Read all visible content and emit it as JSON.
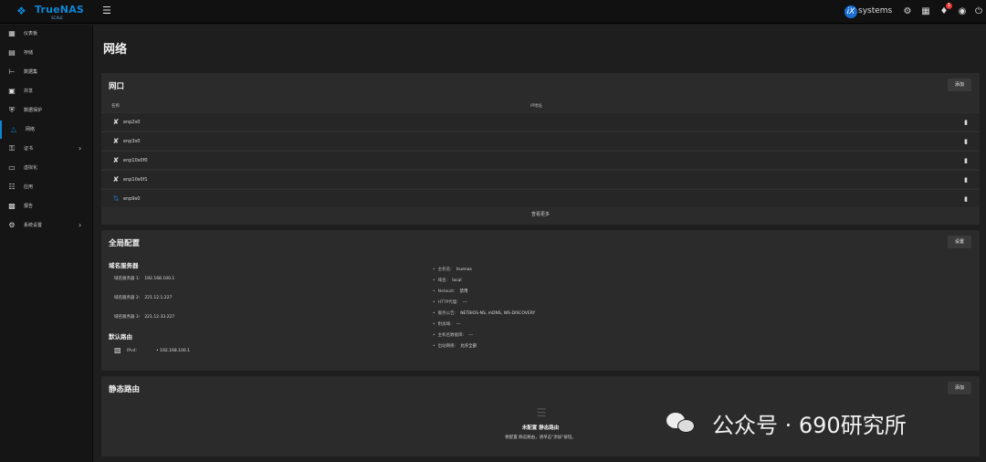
{
  "app": {
    "brand": "TrueNAS",
    "brand_sub": "SCALE",
    "vendor": "systems"
  },
  "colors": {
    "accent": "#0d86d4",
    "badge": "#e53935"
  },
  "topbar": {
    "menu_icon": "hamburger-icon",
    "icons": [
      "truecommand-icon",
      "clipboard-icon",
      "bell-icon",
      "account-icon",
      "power-icon"
    ],
    "notification_count": "1"
  },
  "sidebar": {
    "items": [
      {
        "label": "仪表板",
        "icon": "dashboard-icon",
        "active": false,
        "expandable": false
      },
      {
        "label": "存储",
        "icon": "storage-icon",
        "active": false,
        "expandable": false
      },
      {
        "label": "数据集",
        "icon": "datasets-icon",
        "active": false,
        "expandable": false
      },
      {
        "label": "共享",
        "icon": "shares-icon",
        "active": false,
        "expandable": false
      },
      {
        "label": "数据保护",
        "icon": "shield-icon",
        "active": false,
        "expandable": false
      },
      {
        "label": "网络",
        "icon": "network-icon",
        "active": true,
        "expandable": false
      },
      {
        "label": "证书",
        "icon": "key-icon",
        "active": false,
        "expandable": true
      },
      {
        "label": "虚拟化",
        "icon": "laptop-icon",
        "active": false,
        "expandable": false
      },
      {
        "label": "应用",
        "icon": "apps-icon",
        "active": false,
        "expandable": false
      },
      {
        "label": "报告",
        "icon": "reports-icon",
        "active": false,
        "expandable": false
      },
      {
        "label": "系统设置",
        "icon": "gear-icon",
        "active": false,
        "expandable": true
      }
    ]
  },
  "page": {
    "title": "网络"
  },
  "interfaces": {
    "title": "网口",
    "add_label": "添加",
    "columns": [
      "名称",
      "IP地址"
    ],
    "rows": [
      {
        "name": "enp2s0",
        "icon": "link-off-icon",
        "link_up": false
      },
      {
        "name": "enp3s0",
        "icon": "link-off-icon",
        "link_up": false
      },
      {
        "name": "enp10s0f0",
        "icon": "link-off-icon",
        "link_up": false
      },
      {
        "name": "enp10s0f1",
        "icon": "link-off-icon",
        "link_up": false
      },
      {
        "name": "enp9s0",
        "icon": "link-icon",
        "link_up": true
      }
    ],
    "more_label": "查看更多"
  },
  "global": {
    "title": "全局配置",
    "settings_label": "设置",
    "dns_heading": "域名服务器",
    "dns": [
      {
        "label": "域名服务器 1:",
        "value": "192.168.100.1"
      },
      {
        "label": "域名服务器 2:",
        "value": "221.12.1.227"
      },
      {
        "label": "域名服务器 3:",
        "value": "221.12.33.227"
      }
    ],
    "route_heading": "默认路由",
    "route": {
      "label": "IPv4:",
      "value": "192.168.100.1"
    },
    "info": [
      {
        "label": "主机名:",
        "value": "truenas"
      },
      {
        "label": "域名:",
        "value": "local"
      },
      {
        "label": "Netwait:",
        "value": "禁用"
      },
      {
        "label": "HTTP代理:",
        "value": "---"
      },
      {
        "label": "服务公告:",
        "value": "NETBIOS-NS, mDNS, WS-DISCOVERY"
      },
      {
        "label": "附加域:",
        "value": "---"
      },
      {
        "label": "主机名数据库:",
        "value": "---"
      },
      {
        "label": "出站网络:",
        "value": "允许全部"
      }
    ]
  },
  "static_routes": {
    "title": "静态路由",
    "add_label": "添加",
    "empty_title": "未配置 静态路由",
    "empty_subtitle": "要配置 静态路由，请单击\"添加\"按钮。"
  },
  "watermark": {
    "text": "公众号 · 690研究所"
  }
}
